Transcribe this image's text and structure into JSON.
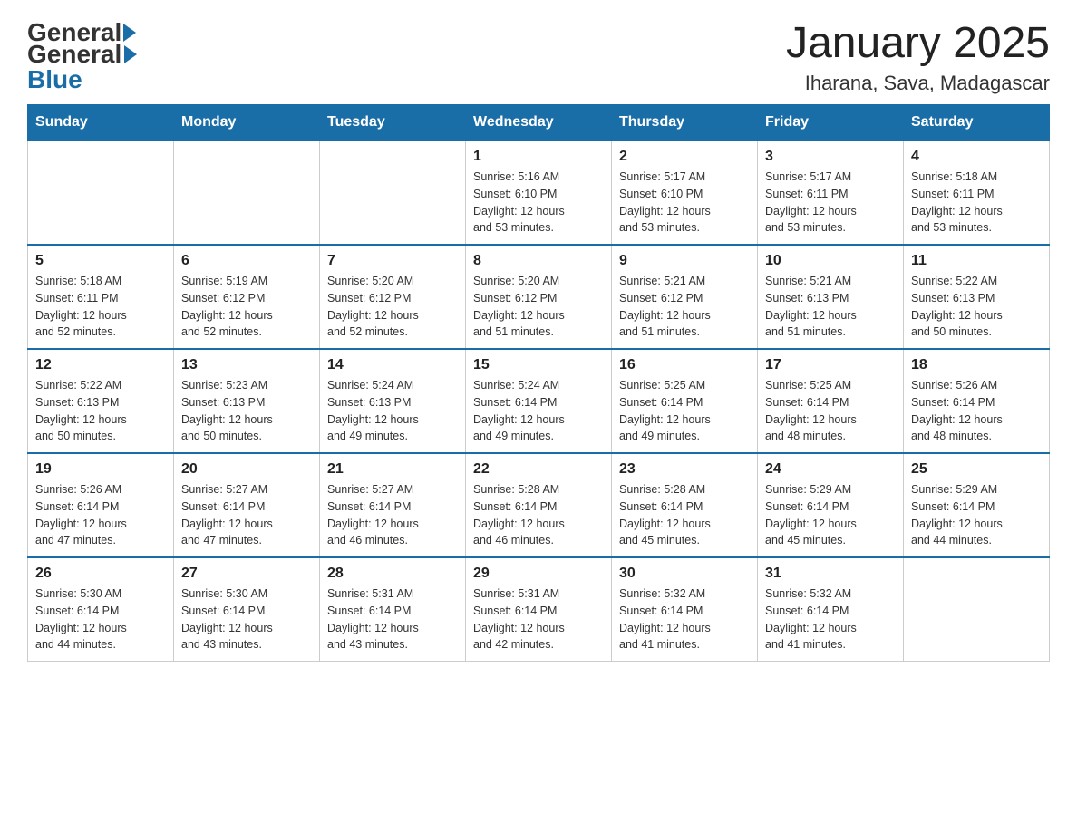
{
  "header": {
    "logo_general": "General",
    "logo_blue": "Blue",
    "month_title": "January 2025",
    "location": "Iharana, Sava, Madagascar"
  },
  "weekdays": [
    "Sunday",
    "Monday",
    "Tuesday",
    "Wednesday",
    "Thursday",
    "Friday",
    "Saturday"
  ],
  "weeks": [
    [
      {
        "day": "",
        "info": ""
      },
      {
        "day": "",
        "info": ""
      },
      {
        "day": "",
        "info": ""
      },
      {
        "day": "1",
        "info": "Sunrise: 5:16 AM\nSunset: 6:10 PM\nDaylight: 12 hours\nand 53 minutes."
      },
      {
        "day": "2",
        "info": "Sunrise: 5:17 AM\nSunset: 6:10 PM\nDaylight: 12 hours\nand 53 minutes."
      },
      {
        "day": "3",
        "info": "Sunrise: 5:17 AM\nSunset: 6:11 PM\nDaylight: 12 hours\nand 53 minutes."
      },
      {
        "day": "4",
        "info": "Sunrise: 5:18 AM\nSunset: 6:11 PM\nDaylight: 12 hours\nand 53 minutes."
      }
    ],
    [
      {
        "day": "5",
        "info": "Sunrise: 5:18 AM\nSunset: 6:11 PM\nDaylight: 12 hours\nand 52 minutes."
      },
      {
        "day": "6",
        "info": "Sunrise: 5:19 AM\nSunset: 6:12 PM\nDaylight: 12 hours\nand 52 minutes."
      },
      {
        "day": "7",
        "info": "Sunrise: 5:20 AM\nSunset: 6:12 PM\nDaylight: 12 hours\nand 52 minutes."
      },
      {
        "day": "8",
        "info": "Sunrise: 5:20 AM\nSunset: 6:12 PM\nDaylight: 12 hours\nand 51 minutes."
      },
      {
        "day": "9",
        "info": "Sunrise: 5:21 AM\nSunset: 6:12 PM\nDaylight: 12 hours\nand 51 minutes."
      },
      {
        "day": "10",
        "info": "Sunrise: 5:21 AM\nSunset: 6:13 PM\nDaylight: 12 hours\nand 51 minutes."
      },
      {
        "day": "11",
        "info": "Sunrise: 5:22 AM\nSunset: 6:13 PM\nDaylight: 12 hours\nand 50 minutes."
      }
    ],
    [
      {
        "day": "12",
        "info": "Sunrise: 5:22 AM\nSunset: 6:13 PM\nDaylight: 12 hours\nand 50 minutes."
      },
      {
        "day": "13",
        "info": "Sunrise: 5:23 AM\nSunset: 6:13 PM\nDaylight: 12 hours\nand 50 minutes."
      },
      {
        "day": "14",
        "info": "Sunrise: 5:24 AM\nSunset: 6:13 PM\nDaylight: 12 hours\nand 49 minutes."
      },
      {
        "day": "15",
        "info": "Sunrise: 5:24 AM\nSunset: 6:14 PM\nDaylight: 12 hours\nand 49 minutes."
      },
      {
        "day": "16",
        "info": "Sunrise: 5:25 AM\nSunset: 6:14 PM\nDaylight: 12 hours\nand 49 minutes."
      },
      {
        "day": "17",
        "info": "Sunrise: 5:25 AM\nSunset: 6:14 PM\nDaylight: 12 hours\nand 48 minutes."
      },
      {
        "day": "18",
        "info": "Sunrise: 5:26 AM\nSunset: 6:14 PM\nDaylight: 12 hours\nand 48 minutes."
      }
    ],
    [
      {
        "day": "19",
        "info": "Sunrise: 5:26 AM\nSunset: 6:14 PM\nDaylight: 12 hours\nand 47 minutes."
      },
      {
        "day": "20",
        "info": "Sunrise: 5:27 AM\nSunset: 6:14 PM\nDaylight: 12 hours\nand 47 minutes."
      },
      {
        "day": "21",
        "info": "Sunrise: 5:27 AM\nSunset: 6:14 PM\nDaylight: 12 hours\nand 46 minutes."
      },
      {
        "day": "22",
        "info": "Sunrise: 5:28 AM\nSunset: 6:14 PM\nDaylight: 12 hours\nand 46 minutes."
      },
      {
        "day": "23",
        "info": "Sunrise: 5:28 AM\nSunset: 6:14 PM\nDaylight: 12 hours\nand 45 minutes."
      },
      {
        "day": "24",
        "info": "Sunrise: 5:29 AM\nSunset: 6:14 PM\nDaylight: 12 hours\nand 45 minutes."
      },
      {
        "day": "25",
        "info": "Sunrise: 5:29 AM\nSunset: 6:14 PM\nDaylight: 12 hours\nand 44 minutes."
      }
    ],
    [
      {
        "day": "26",
        "info": "Sunrise: 5:30 AM\nSunset: 6:14 PM\nDaylight: 12 hours\nand 44 minutes."
      },
      {
        "day": "27",
        "info": "Sunrise: 5:30 AM\nSunset: 6:14 PM\nDaylight: 12 hours\nand 43 minutes."
      },
      {
        "day": "28",
        "info": "Sunrise: 5:31 AM\nSunset: 6:14 PM\nDaylight: 12 hours\nand 43 minutes."
      },
      {
        "day": "29",
        "info": "Sunrise: 5:31 AM\nSunset: 6:14 PM\nDaylight: 12 hours\nand 42 minutes."
      },
      {
        "day": "30",
        "info": "Sunrise: 5:32 AM\nSunset: 6:14 PM\nDaylight: 12 hours\nand 41 minutes."
      },
      {
        "day": "31",
        "info": "Sunrise: 5:32 AM\nSunset: 6:14 PM\nDaylight: 12 hours\nand 41 minutes."
      },
      {
        "day": "",
        "info": ""
      }
    ]
  ]
}
